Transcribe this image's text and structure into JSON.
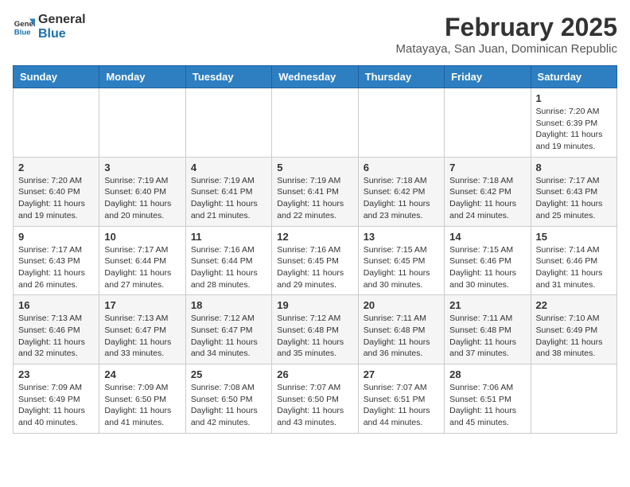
{
  "header": {
    "logo_line1": "General",
    "logo_line2": "Blue",
    "month": "February 2025",
    "location": "Matayaya, San Juan, Dominican Republic"
  },
  "days_of_week": [
    "Sunday",
    "Monday",
    "Tuesday",
    "Wednesday",
    "Thursday",
    "Friday",
    "Saturday"
  ],
  "weeks": [
    [
      {
        "day": "",
        "info": ""
      },
      {
        "day": "",
        "info": ""
      },
      {
        "day": "",
        "info": ""
      },
      {
        "day": "",
        "info": ""
      },
      {
        "day": "",
        "info": ""
      },
      {
        "day": "",
        "info": ""
      },
      {
        "day": "1",
        "info": "Sunrise: 7:20 AM\nSunset: 6:39 PM\nDaylight: 11 hours and 19 minutes."
      }
    ],
    [
      {
        "day": "2",
        "info": "Sunrise: 7:20 AM\nSunset: 6:40 PM\nDaylight: 11 hours and 19 minutes."
      },
      {
        "day": "3",
        "info": "Sunrise: 7:19 AM\nSunset: 6:40 PM\nDaylight: 11 hours and 20 minutes."
      },
      {
        "day": "4",
        "info": "Sunrise: 7:19 AM\nSunset: 6:41 PM\nDaylight: 11 hours and 21 minutes."
      },
      {
        "day": "5",
        "info": "Sunrise: 7:19 AM\nSunset: 6:41 PM\nDaylight: 11 hours and 22 minutes."
      },
      {
        "day": "6",
        "info": "Sunrise: 7:18 AM\nSunset: 6:42 PM\nDaylight: 11 hours and 23 minutes."
      },
      {
        "day": "7",
        "info": "Sunrise: 7:18 AM\nSunset: 6:42 PM\nDaylight: 11 hours and 24 minutes."
      },
      {
        "day": "8",
        "info": "Sunrise: 7:17 AM\nSunset: 6:43 PM\nDaylight: 11 hours and 25 minutes."
      }
    ],
    [
      {
        "day": "9",
        "info": "Sunrise: 7:17 AM\nSunset: 6:43 PM\nDaylight: 11 hours and 26 minutes."
      },
      {
        "day": "10",
        "info": "Sunrise: 7:17 AM\nSunset: 6:44 PM\nDaylight: 11 hours and 27 minutes."
      },
      {
        "day": "11",
        "info": "Sunrise: 7:16 AM\nSunset: 6:44 PM\nDaylight: 11 hours and 28 minutes."
      },
      {
        "day": "12",
        "info": "Sunrise: 7:16 AM\nSunset: 6:45 PM\nDaylight: 11 hours and 29 minutes."
      },
      {
        "day": "13",
        "info": "Sunrise: 7:15 AM\nSunset: 6:45 PM\nDaylight: 11 hours and 30 minutes."
      },
      {
        "day": "14",
        "info": "Sunrise: 7:15 AM\nSunset: 6:46 PM\nDaylight: 11 hours and 30 minutes."
      },
      {
        "day": "15",
        "info": "Sunrise: 7:14 AM\nSunset: 6:46 PM\nDaylight: 11 hours and 31 minutes."
      }
    ],
    [
      {
        "day": "16",
        "info": "Sunrise: 7:13 AM\nSunset: 6:46 PM\nDaylight: 11 hours and 32 minutes."
      },
      {
        "day": "17",
        "info": "Sunrise: 7:13 AM\nSunset: 6:47 PM\nDaylight: 11 hours and 33 minutes."
      },
      {
        "day": "18",
        "info": "Sunrise: 7:12 AM\nSunset: 6:47 PM\nDaylight: 11 hours and 34 minutes."
      },
      {
        "day": "19",
        "info": "Sunrise: 7:12 AM\nSunset: 6:48 PM\nDaylight: 11 hours and 35 minutes."
      },
      {
        "day": "20",
        "info": "Sunrise: 7:11 AM\nSunset: 6:48 PM\nDaylight: 11 hours and 36 minutes."
      },
      {
        "day": "21",
        "info": "Sunrise: 7:11 AM\nSunset: 6:48 PM\nDaylight: 11 hours and 37 minutes."
      },
      {
        "day": "22",
        "info": "Sunrise: 7:10 AM\nSunset: 6:49 PM\nDaylight: 11 hours and 38 minutes."
      }
    ],
    [
      {
        "day": "23",
        "info": "Sunrise: 7:09 AM\nSunset: 6:49 PM\nDaylight: 11 hours and 40 minutes."
      },
      {
        "day": "24",
        "info": "Sunrise: 7:09 AM\nSunset: 6:50 PM\nDaylight: 11 hours and 41 minutes."
      },
      {
        "day": "25",
        "info": "Sunrise: 7:08 AM\nSunset: 6:50 PM\nDaylight: 11 hours and 42 minutes."
      },
      {
        "day": "26",
        "info": "Sunrise: 7:07 AM\nSunset: 6:50 PM\nDaylight: 11 hours and 43 minutes."
      },
      {
        "day": "27",
        "info": "Sunrise: 7:07 AM\nSunset: 6:51 PM\nDaylight: 11 hours and 44 minutes."
      },
      {
        "day": "28",
        "info": "Sunrise: 7:06 AM\nSunset: 6:51 PM\nDaylight: 11 hours and 45 minutes."
      },
      {
        "day": "",
        "info": ""
      }
    ]
  ]
}
